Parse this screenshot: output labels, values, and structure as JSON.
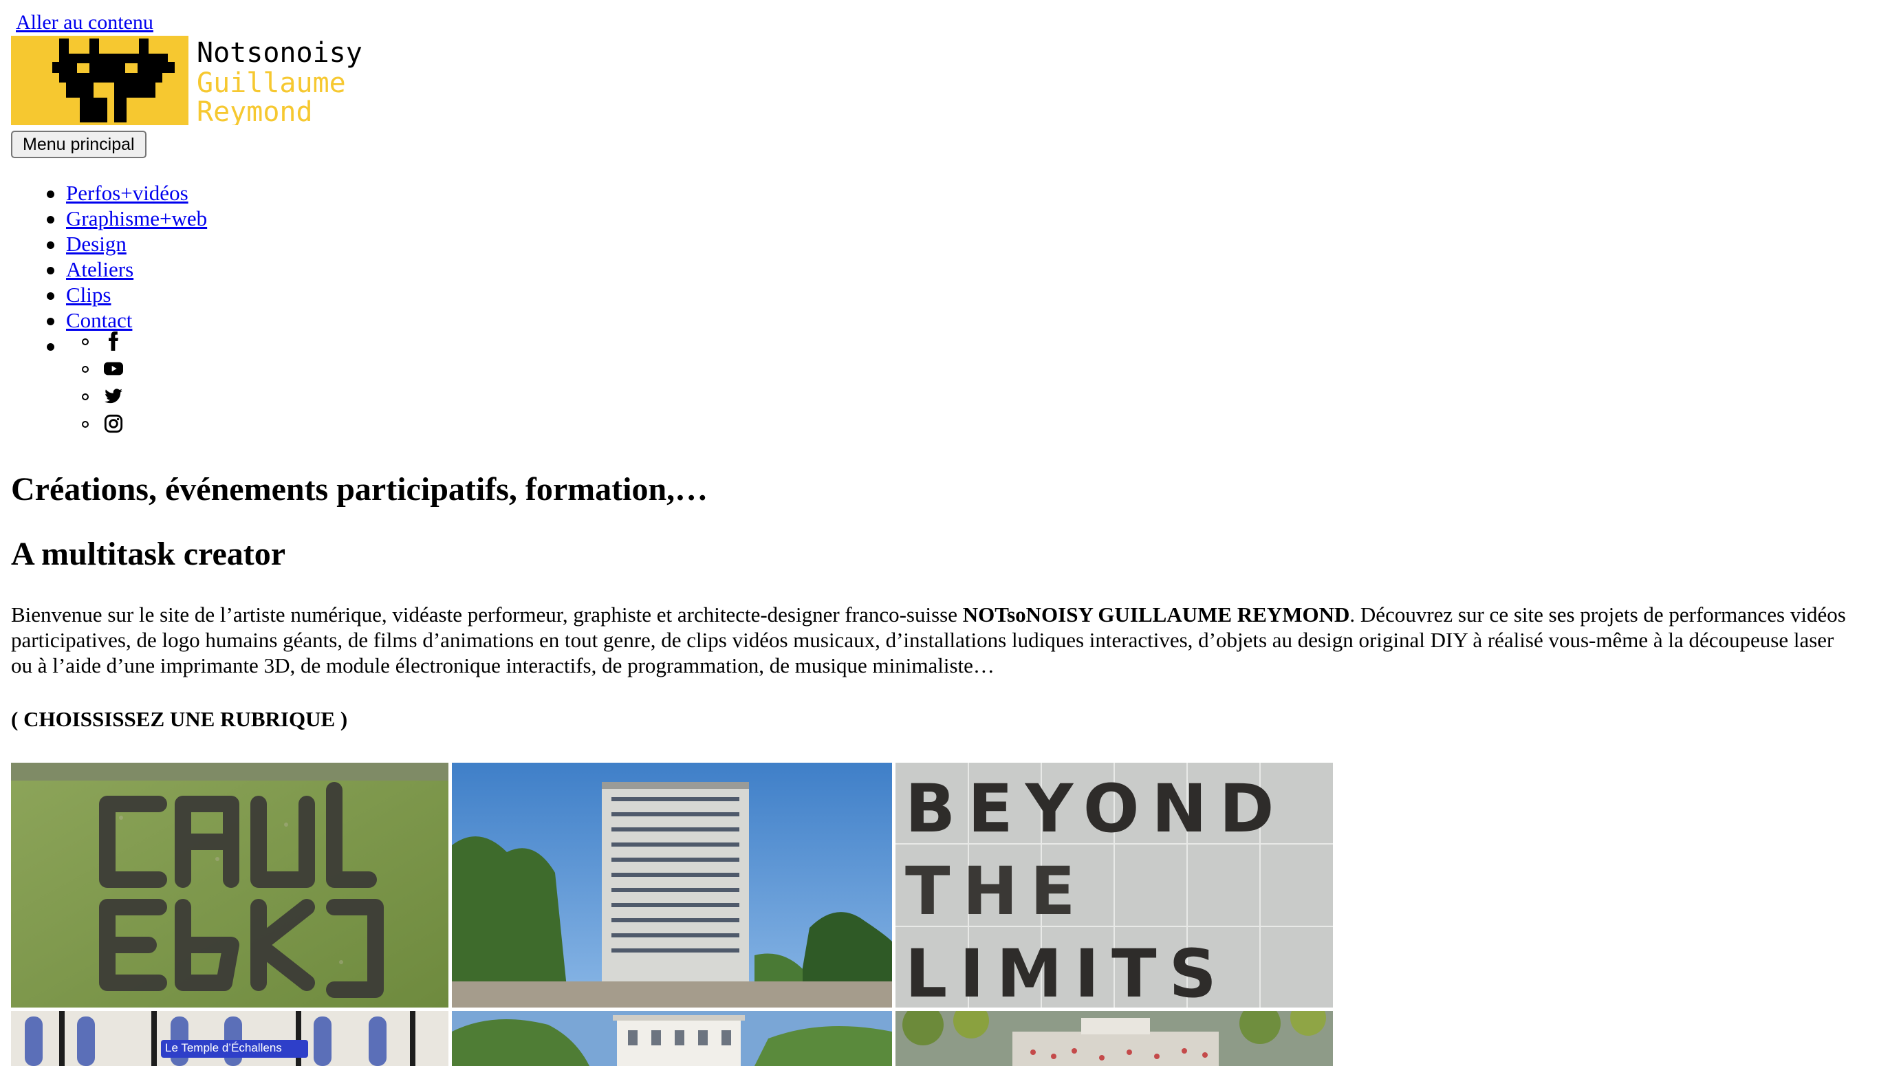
{
  "skip_link": "Aller au contenu",
  "logo": {
    "line1": "Notsonoisy",
    "line2": "Guillaume",
    "line3": "Reymond",
    "brand_yellow": "#f6c830",
    "brand_black": "#000000"
  },
  "menu_button": "Menu principal",
  "nav": {
    "items": [
      {
        "label": "Perfos+vidéos"
      },
      {
        "label": "Graphisme+web"
      },
      {
        "label": "Design"
      },
      {
        "label": "Ateliers"
      },
      {
        "label": "Clips"
      },
      {
        "label": "Contact"
      }
    ],
    "social": [
      "facebook-icon",
      "youtube-icon",
      "twitter-icon",
      "instagram-icon"
    ]
  },
  "main": {
    "title": "Créations, événements participatifs, formation,…",
    "subtitle": "A multitask creator",
    "intro_before": "Bienvenue sur le site de l’artiste numérique, vidéaste performeur, graphiste et architecte-designer franco-suisse ",
    "intro_name": "NOTsoNOISY GUILLAUME REYMOND",
    "intro_after": ". Découvrez sur ce site ses projets de performances vidéos participatives, de logo humains géants, de films d’animations en tout genre, de clips vidéos musicaux, d’installations ludiques interactives, d’objets au design original DIY à réalisé vous-même à la découpeuse laser ou à l’aide d’une imprimante 3D, de module électronique interactifs, de programmation, de musique minimaliste…",
    "choose_label": "( CHOISSISSEZ UNE RUBRIQUE )"
  },
  "gallery": {
    "tiles": [
      {
        "name": "tile-human-logo-aerial"
      },
      {
        "name": "tile-tower-building"
      },
      {
        "name": "tile-beyond-the-limits",
        "text": "BEYOND THE LIMITS"
      },
      {
        "name": "tile-temple",
        "caption": "Le Temple d’Échallens"
      },
      {
        "name": "tile-villa"
      },
      {
        "name": "tile-plaza"
      }
    ]
  }
}
